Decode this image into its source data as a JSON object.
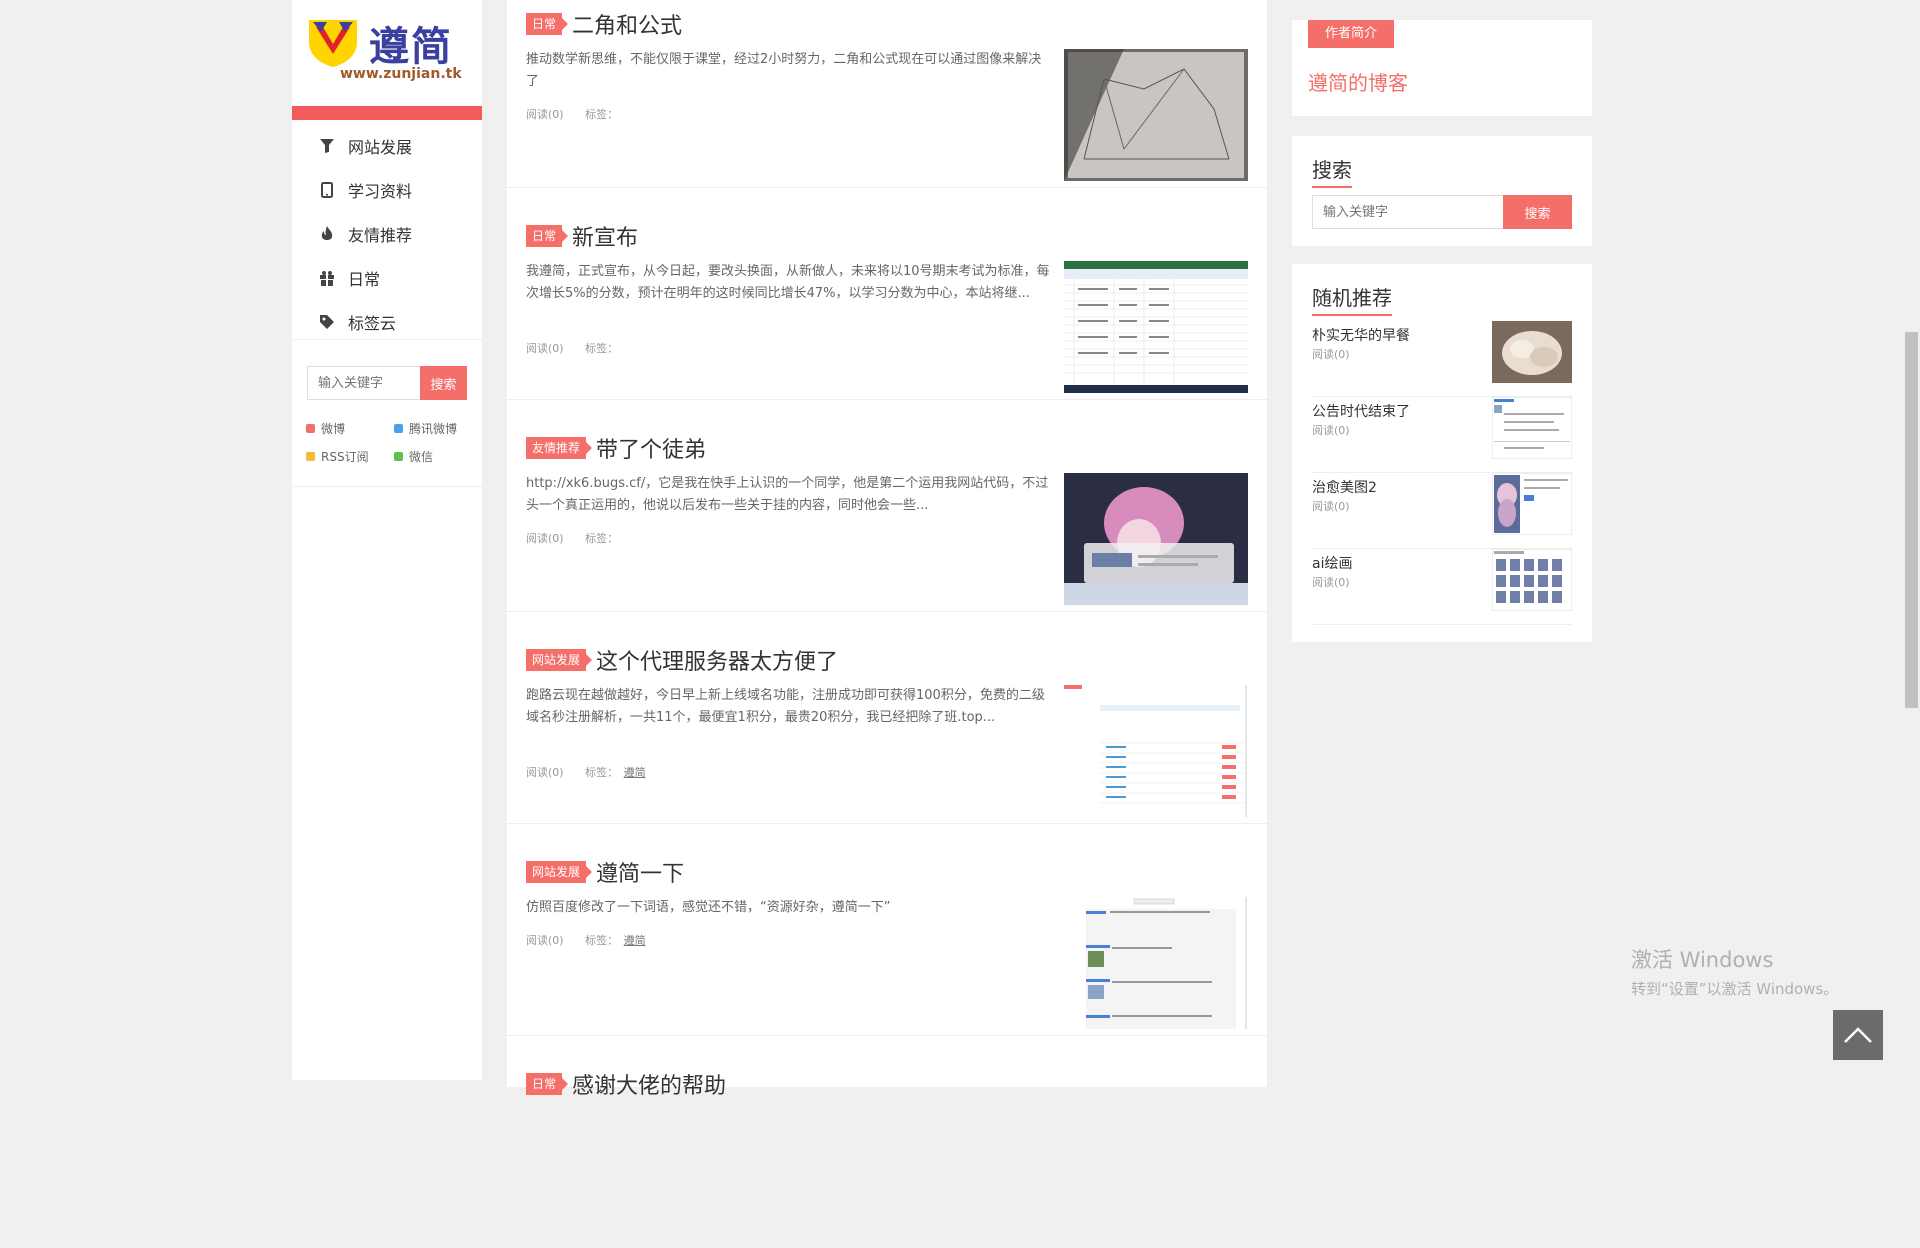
{
  "sidebar": {
    "logo": {
      "text": "遵简",
      "url": "www.zunjian.tk"
    },
    "nav": [
      {
        "label": "网站发展",
        "icon": "funnel-icon"
      },
      {
        "label": "学习资料",
        "icon": "mobile-icon"
      },
      {
        "label": "友情推荐",
        "icon": "flame-icon"
      },
      {
        "label": "日常",
        "icon": "gift-icon"
      },
      {
        "label": "标签云",
        "icon": "tag-icon"
      }
    ],
    "search": {
      "placeholder": "输入关键字",
      "button": "搜索"
    },
    "social": [
      {
        "label": "微博",
        "color": "#f46f6a"
      },
      {
        "label": "腾讯微博",
        "color": "#4aa3ea"
      },
      {
        "label": "RSS订阅",
        "color": "#f5b93b"
      },
      {
        "label": "微信",
        "color": "#5cc24a"
      }
    ]
  },
  "posts": [
    {
      "category": "日常",
      "title": "二角和公式",
      "excerpt": "推动数学新思维，不能仅限于课堂，经过2小时努力，二角和公式现在可以通过图像来解决了",
      "read": "阅读(0)",
      "tags_label": "标签：",
      "tag": "",
      "thumb": "geometry-sketch"
    },
    {
      "category": "日常",
      "title": "新宣布",
      "excerpt": "我遵简，正式宣布，从今日起，要改头换面，从新做人，未来将以10号期末考试为标准，每次增长5%的分数，预计在明年的这时候同比增长47%，以学习分数为中心，本站将继...",
      "read": "阅读(0)",
      "tags_label": "标签：",
      "tag": "",
      "thumb": "spreadsheet"
    },
    {
      "category": "友情推荐",
      "title": "带了个徒弟",
      "excerpt": "http://xk6.bugs.cf/，它是我在快手上认识的一个同学，他是第二个运用我网站代码，不过头一个真正运用的，他说以后发布一些关于挂的内容，同时他会一些...",
      "read": "阅读(0)",
      "tags_label": "标签：",
      "tag": "",
      "thumb": "anime-screen"
    },
    {
      "category": "网站发展",
      "title": "这个代理服务器太方便了",
      "excerpt": "跑路云现在越做越好，今日早上新上线域名功能，注册成功即可获得100积分，免费的二级域名秒注册解析，一共11个，最便宜1积分，最贵20积分，我已经把除了班.top...",
      "read": "阅读(0)",
      "tags_label": "标签：",
      "tag": "遵简",
      "thumb": "web-admin"
    },
    {
      "category": "网站发展",
      "title": "遵简一下",
      "excerpt": "仿照百度修改了一下词语，感觉还不错，“资源好杂，遵简一下”",
      "read": "阅读(0)",
      "tags_label": "标签：",
      "tag": "遵简",
      "thumb": "search-results"
    },
    {
      "category": "日常",
      "title": "感谢大佬的帮助",
      "excerpt": "",
      "read": "",
      "tags_label": "",
      "tag": "",
      "thumb": ""
    }
  ],
  "author": {
    "tag": "作者简介",
    "link": "遵简的博客"
  },
  "right_search": {
    "heading": "搜索",
    "placeholder": "输入关键字",
    "button": "搜索"
  },
  "random": {
    "heading": "随机推荐",
    "items": [
      {
        "title": "朴实无华的早餐",
        "read": "阅读(0)",
        "thumb": "food-photo"
      },
      {
        "title": "公告时代结束了",
        "read": "阅读(0)",
        "thumb": "web-page"
      },
      {
        "title": "治愈美图2",
        "read": "阅读(0)",
        "thumb": "anime-page"
      },
      {
        "title": "ai绘画",
        "read": "阅读(0)",
        "thumb": "image-grid"
      }
    ]
  },
  "watermark": {
    "line1": "激活 Windows",
    "line2": "转到“设置”以激活 Windows。"
  },
  "colors": {
    "accent": "#f46f6a",
    "background": "#f0f0f0"
  }
}
